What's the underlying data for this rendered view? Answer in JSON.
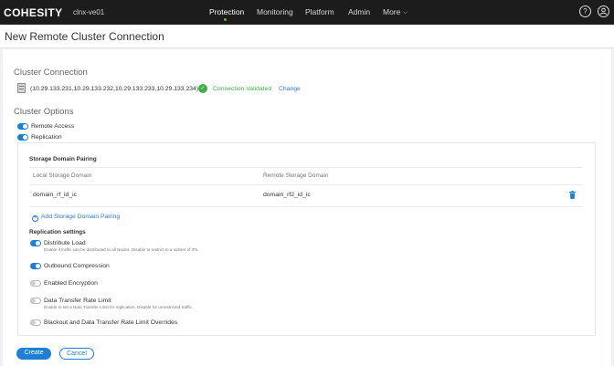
{
  "topbar": {
    "logo": "COHESITY",
    "cluster_name": "clnx-ve01",
    "nav": [
      "Protection",
      "Monitoring",
      "Platform",
      "Admin",
      "More"
    ],
    "active_nav": "Protection",
    "help_glyph": "?",
    "icons": [
      "help-icon",
      "user-account-icon",
      "chevron-down-icon"
    ]
  },
  "page": {
    "title": "New Remote Cluster Connection"
  },
  "cluster_connection": {
    "section_title": "Cluster Connection",
    "ips": "(10.29.133.231,10.29.133.232,10.29.133.233,10.29.133.234)",
    "status": "Connection Validated",
    "change_label": "Change",
    "status_color": "#3fae49"
  },
  "cluster_options": {
    "section_title": "Cluster Options",
    "remote_access": {
      "label": "Remote Access",
      "on": true
    },
    "replication": {
      "label": "Replication",
      "on": true
    }
  },
  "storage_pairing": {
    "title": "Storage Domain Pairing",
    "columns": [
      "Local Storage Domain",
      "Remote Storage Domain"
    ],
    "rows": [
      {
        "local": "domain_rf_id_ic",
        "remote": "domain_rf2_id_ic"
      }
    ],
    "add_label": "Add Storage Domain Pairing"
  },
  "replication_settings": {
    "title": "Replication settings",
    "items": [
      {
        "label": "Distribute Load",
        "on": true,
        "help": "Enable if traffic can be distributed to all Nodes. Disable to restrict to a subset of IPs."
      },
      {
        "label": "Outbound Compression",
        "on": true
      },
      {
        "label": "Enabled Encryption",
        "on": false
      },
      {
        "label": "Data Transfer Rate Limit",
        "on": false,
        "help": "Enable to set a Data Transfer Limit for replication. Disable for unrestricted traffic."
      },
      {
        "label": "Blackout and Data Transfer Rate Limit Overrides",
        "on": false
      }
    ]
  },
  "actions": {
    "create_label": "Create",
    "cancel_label": "Cancel"
  },
  "colors": {
    "accent": "#1e7fd6",
    "topbar_bg": "#1c1c1c",
    "link": "#2d7ad6"
  }
}
